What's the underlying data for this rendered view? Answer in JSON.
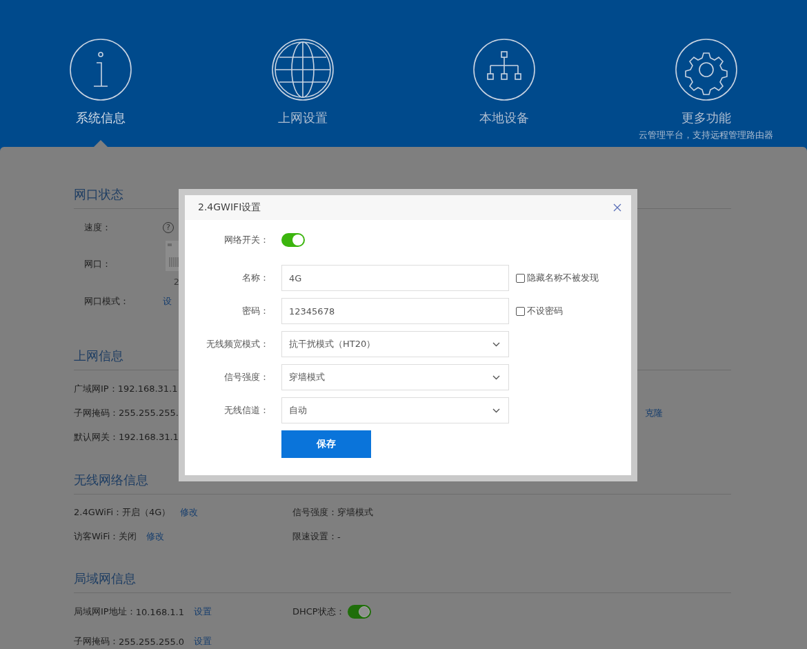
{
  "nav": [
    {
      "label": "系统信息",
      "selected": true
    },
    {
      "label": "上网设置",
      "selected": false
    },
    {
      "label": "本地设备",
      "selected": false
    },
    {
      "label": "更多功能",
      "selected": false,
      "subtitle": "云管理平台，支持远程管理路由器"
    }
  ],
  "port_status": {
    "title": "网口状态",
    "speed_label": "速度：",
    "help": "?",
    "port_label": "网口：",
    "port_number": "2",
    "mode_label": "网口模式：",
    "mode_link": "设"
  },
  "internet": {
    "title": "上网信息",
    "rows": [
      {
        "label": "广域网IP：",
        "value": "192.168.31.1"
      },
      {
        "label": "子网掩码：",
        "value": "255.255.255."
      },
      {
        "label": "默认网关：",
        "value": "192.168.31.1"
      }
    ],
    "clone_link": "克隆"
  },
  "wireless": {
    "title": "无线网络信息",
    "rows": [
      {
        "label": "2.4GWiFi：",
        "value": "开启（4G）",
        "link": "修改",
        "right_label": "信号强度：",
        "right_value": "穿墙模式"
      },
      {
        "label": "访客WiFi：",
        "value": "关闭",
        "link": "修改",
        "right_label": "限速设置：",
        "right_value": "-"
      }
    ]
  },
  "lan": {
    "title": "局域网信息",
    "ip_label": "局域网IP地址：",
    "ip_value": "10.168.1.1",
    "ip_link": "设置",
    "dhcp_label": "DHCP状态：",
    "dhcp_on": true,
    "mask_label": "子网掩码：",
    "mask_value": "255.255.255.0",
    "mask_link": "设置"
  },
  "modal": {
    "title": "2.4GWIFI设置",
    "fields": [
      {
        "kind": "toggle",
        "label": "网络开关：",
        "on": true
      },
      {
        "kind": "input",
        "label": "名称：",
        "value": "4G",
        "checkbox": {
          "label": "隐藏名称不被发现",
          "checked": false
        }
      },
      {
        "kind": "input",
        "label": "密码：",
        "value": "12345678",
        "checkbox": {
          "label": "不设密码",
          "checked": false
        }
      },
      {
        "kind": "select",
        "label": "无线频宽模式：",
        "value": "抗干扰模式（HT20）"
      },
      {
        "kind": "select",
        "label": "信号强度：",
        "value": "穿墙模式"
      },
      {
        "kind": "select",
        "label": "无线信道：",
        "value": "自动"
      }
    ],
    "save": "保存"
  }
}
